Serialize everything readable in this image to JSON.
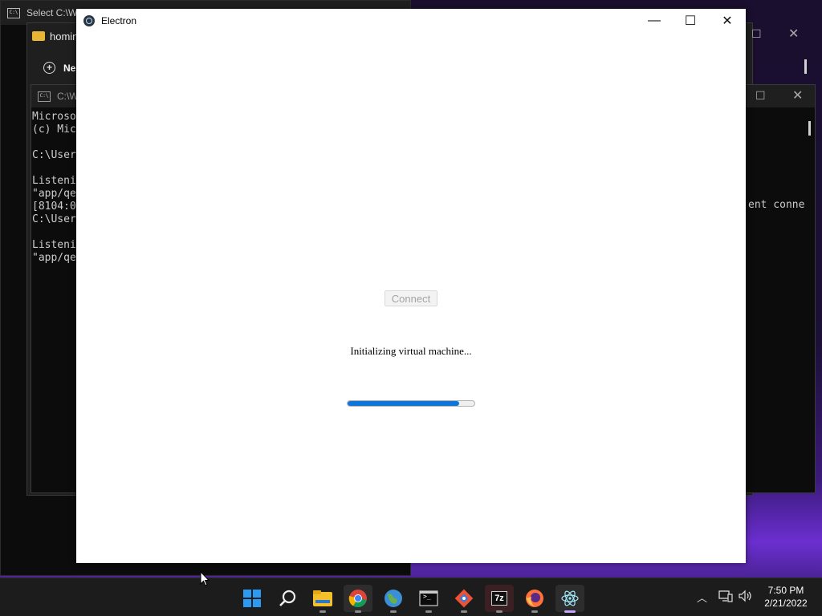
{
  "background_windows": {
    "term1_title": "Select C:\\Wi",
    "explorer_tab": "homin",
    "explorer_new": "Ne",
    "term2_title": "C:\\Wi",
    "term2_lines": [
      "Microso",
      "(c) Mic",
      "",
      "C:\\User",
      "",
      "Listeni",
      "\"app/qe",
      "[8104:0",
      "C:\\User",
      "",
      "Listeni",
      "\"app/qe"
    ],
    "term2_right_text": "ent conne"
  },
  "electron": {
    "title": "Electron",
    "minimize_glyph": "—",
    "maximize_glyph": "☐",
    "close_glyph": "✕",
    "connect_label": "Connect",
    "status": "Initializing virtual machine...",
    "progress_percent": 88
  },
  "taskbar": {
    "time": "7:50 PM",
    "date": "2/21/2022",
    "icons": [
      "windows-start-icon",
      "search-icon",
      "file-explorer-icon",
      "chrome-icon",
      "maps-icon",
      "terminal-icon",
      "git-icon",
      "7zip-icon",
      "firefox-icon",
      "electron-icon"
    ],
    "sevenzip_label": "7z",
    "terminal_label": ">_"
  },
  "colors": {
    "accent_progress": "#0f75d8",
    "taskbar_bg": "#1c1c1c"
  }
}
